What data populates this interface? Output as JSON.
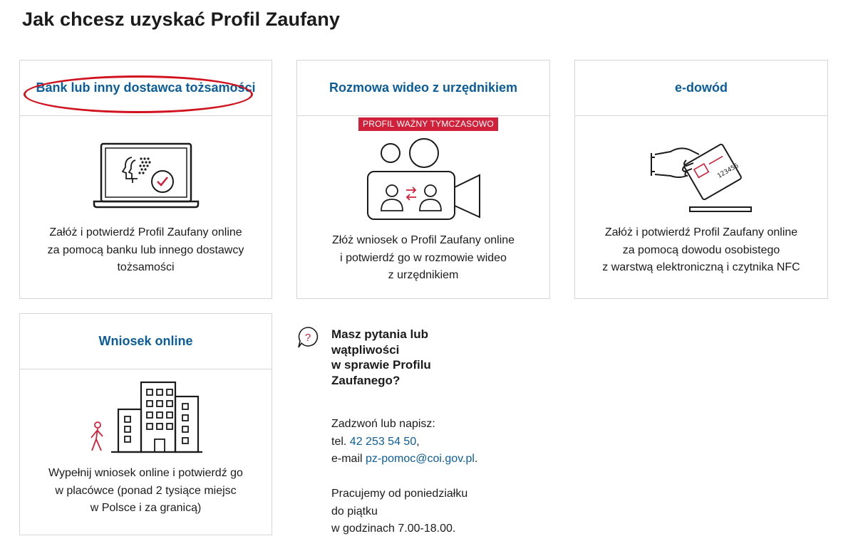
{
  "page_title": "Jak chcesz uzyskać Profil Zaufany",
  "colors": {
    "heading_blue": "#0b5d99",
    "accent_red": "#d1213a",
    "annotation_red": "#d1121f",
    "border": "#d6d6d6"
  },
  "cards": [
    {
      "title": "Bank lub inny dostawca tożsamości",
      "icon": "laptop-identity-icon",
      "text": [
        "Załóż i potwierdź Profil Zaufany online",
        "za pomocą banku lub innego dostawcy",
        "tożsamości"
      ]
    },
    {
      "title": "Rozmowa wideo z urzędnikiem",
      "badge": "PROFIL WAŻNY TYMCZASOWO",
      "icon": "video-call-icon",
      "text": [
        "Złóż wniosek o Profil Zaufany online",
        "i potwierdź go w rozmowie wideo",
        "z urzędnikiem"
      ]
    },
    {
      "title": "e-dowód",
      "icon": "id-card-hand-icon",
      "card_number": "123456",
      "text": [
        "Załóż i potwierdź Profil Zaufany online",
        "za pomocą dowodu osobistego",
        "z warstwą elektroniczną i czytnika NFC"
      ]
    },
    {
      "title": "Wniosek online",
      "icon": "buildings-walking-person-icon",
      "text": [
        "Wypełnij wniosek online i potwierdź go",
        "w placówce (ponad 2 tysiące miejsc",
        "w Polsce i za granicą)"
      ]
    }
  ],
  "help": {
    "icon": "question-bubble-icon",
    "heading": [
      "Masz pytania lub",
      "wątpliwości",
      "w sprawie Profilu",
      "Zaufanego?"
    ],
    "contact_intro": "Zadzwoń lub napisz:",
    "tel_label": "tel.",
    "tel_value": "42 253 54 50",
    "tel_suffix": ",",
    "email_label": "e-mail",
    "email_value": "pz-pomoc@coi.gov.pl",
    "email_suffix": ".",
    "hours": [
      "Pracujemy od poniedziałku",
      "do piątku",
      "w godzinach 7.00-18.00."
    ]
  }
}
